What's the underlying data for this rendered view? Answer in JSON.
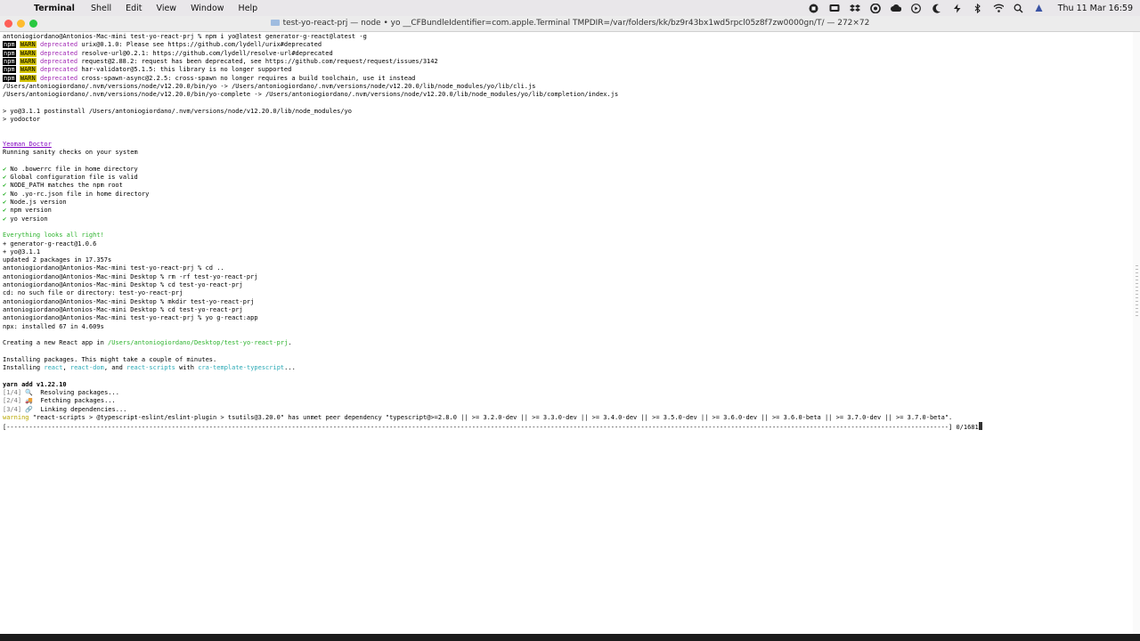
{
  "menubar": {
    "apple_glyph": "",
    "items": [
      "Terminal",
      "Shell",
      "Edit",
      "View",
      "Window",
      "Help"
    ],
    "clock": "Thu 11 Mar  16:59"
  },
  "window": {
    "title": "test-yo-react-prj — node • yo __CFBundleIdentifier=com.apple.Terminal TMPDIR=/var/folders/kk/bz9r43bx1wd5rpcl05z8f7zw0000gn/T/ — 272×72"
  },
  "terminal": {
    "lines": [
      {
        "segs": [
          [
            "",
            "antoniogiordano@Antonios-Mac-mini test-yo-react-prj % npm i yo@latest generator-g-react@latest -g"
          ]
        ]
      },
      {
        "segs": [
          [
            "npm",
            "npm"
          ],
          [
            "",
            " "
          ],
          [
            "warn",
            "WARN"
          ],
          [
            "",
            " "
          ],
          [
            "mag",
            "deprecated"
          ],
          [
            "",
            " urix@0.1.0: Please see https://github.com/lydell/urix#deprecated"
          ]
        ]
      },
      {
        "segs": [
          [
            "npm",
            "npm"
          ],
          [
            "",
            " "
          ],
          [
            "warn",
            "WARN"
          ],
          [
            "",
            " "
          ],
          [
            "mag",
            "deprecated"
          ],
          [
            "",
            " resolve-url@0.2.1: https://github.com/lydell/resolve-url#deprecated"
          ]
        ]
      },
      {
        "segs": [
          [
            "npm",
            "npm"
          ],
          [
            "",
            " "
          ],
          [
            "warn",
            "WARN"
          ],
          [
            "",
            " "
          ],
          [
            "mag",
            "deprecated"
          ],
          [
            "",
            " request@2.88.2: request has been deprecated, see https://github.com/request/request/issues/3142"
          ]
        ]
      },
      {
        "segs": [
          [
            "npm",
            "npm"
          ],
          [
            "",
            " "
          ],
          [
            "warn",
            "WARN"
          ],
          [
            "",
            " "
          ],
          [
            "mag",
            "deprecated"
          ],
          [
            "",
            " har-validator@5.1.5: this library is no longer supported"
          ]
        ]
      },
      {
        "segs": [
          [
            "npm",
            "npm"
          ],
          [
            "",
            " "
          ],
          [
            "warn",
            "WARN"
          ],
          [
            "",
            " "
          ],
          [
            "mag",
            "deprecated"
          ],
          [
            "",
            " cross-spawn-async@2.2.5: cross-spawn no longer requires a build toolchain, use it instead"
          ]
        ]
      },
      {
        "segs": [
          [
            "",
            "/Users/antoniogiordano/.nvm/versions/node/v12.20.0/bin/yo -> /Users/antoniogiordano/.nvm/versions/node/v12.20.0/lib/node_modules/yo/lib/cli.js"
          ]
        ]
      },
      {
        "segs": [
          [
            "",
            "/Users/antoniogiordano/.nvm/versions/node/v12.20.0/bin/yo-complete -> /Users/antoniogiordano/.nvm/versions/node/v12.20.0/lib/node_modules/yo/lib/completion/index.js"
          ]
        ]
      },
      {
        "segs": [
          [
            "",
            ""
          ]
        ]
      },
      {
        "segs": [
          [
            "",
            "> yo@3.1.1 postinstall /Users/antoniogiordano/.nvm/versions/node/v12.20.0/lib/node_modules/yo"
          ]
        ]
      },
      {
        "segs": [
          [
            "",
            "> yodoctor"
          ]
        ]
      },
      {
        "segs": [
          [
            "",
            ""
          ]
        ]
      },
      {
        "segs": [
          [
            "",
            ""
          ]
        ]
      },
      {
        "segs": [
          [
            "link",
            "Yeoman Doctor"
          ]
        ]
      },
      {
        "segs": [
          [
            "",
            "Running sanity checks on your system"
          ]
        ]
      },
      {
        "segs": [
          [
            "",
            ""
          ]
        ]
      },
      {
        "segs": [
          [
            "green",
            "✔"
          ],
          [
            "",
            " No .bowerrc file in home directory"
          ]
        ]
      },
      {
        "segs": [
          [
            "green",
            "✔"
          ],
          [
            "",
            " Global configuration file is valid"
          ]
        ]
      },
      {
        "segs": [
          [
            "green",
            "✔"
          ],
          [
            "",
            " NODE_PATH matches the npm root"
          ]
        ]
      },
      {
        "segs": [
          [
            "green",
            "✔"
          ],
          [
            "",
            " No .yo-rc.json file in home directory"
          ]
        ]
      },
      {
        "segs": [
          [
            "green",
            "✔"
          ],
          [
            "",
            " Node.js version"
          ]
        ]
      },
      {
        "segs": [
          [
            "green",
            "✔"
          ],
          [
            "",
            " npm version"
          ]
        ]
      },
      {
        "segs": [
          [
            "green",
            "✔"
          ],
          [
            "",
            " yo version"
          ]
        ]
      },
      {
        "segs": [
          [
            "",
            ""
          ]
        ]
      },
      {
        "segs": [
          [
            "green",
            "Everything looks all right!"
          ]
        ]
      },
      {
        "segs": [
          [
            "",
            "+ generator-g-react@1.0.6"
          ]
        ]
      },
      {
        "segs": [
          [
            "",
            "+ yo@3.1.1"
          ]
        ]
      },
      {
        "segs": [
          [
            "",
            "updated 2 packages in 17.357s"
          ]
        ]
      },
      {
        "segs": [
          [
            "",
            "antoniogiordano@Antonios-Mac-mini test-yo-react-prj % cd .."
          ]
        ]
      },
      {
        "segs": [
          [
            "",
            "antoniogiordano@Antonios-Mac-mini Desktop % rm -rf test-yo-react-prj"
          ]
        ]
      },
      {
        "segs": [
          [
            "",
            "antoniogiordano@Antonios-Mac-mini Desktop % cd test-yo-react-prj"
          ]
        ]
      },
      {
        "segs": [
          [
            "",
            "cd: no such file or directory: test-yo-react-prj"
          ]
        ]
      },
      {
        "segs": [
          [
            "",
            "antoniogiordano@Antonios-Mac-mini Desktop % mkdir test-yo-react-prj"
          ]
        ]
      },
      {
        "segs": [
          [
            "",
            "antoniogiordano@Antonios-Mac-mini Desktop % cd test-yo-react-prj"
          ]
        ]
      },
      {
        "segs": [
          [
            "",
            "antoniogiordano@Antonios-Mac-mini test-yo-react-prj % yo g-react:app"
          ]
        ]
      },
      {
        "segs": [
          [
            "",
            "npx: installed 67 in 4.609s"
          ]
        ]
      },
      {
        "segs": [
          [
            "",
            ""
          ]
        ]
      },
      {
        "segs": [
          [
            "",
            "Creating a new React app in "
          ],
          [
            "green",
            "/Users/antoniogiordano/Desktop/test-yo-react-prj"
          ],
          [
            "",
            "."
          ]
        ]
      },
      {
        "segs": [
          [
            "",
            ""
          ]
        ]
      },
      {
        "segs": [
          [
            "",
            "Installing packages. This might take a couple of minutes."
          ]
        ]
      },
      {
        "segs": [
          [
            "",
            "Installing "
          ],
          [
            "cyan",
            "react"
          ],
          [
            "",
            ", "
          ],
          [
            "cyan",
            "react-dom"
          ],
          [
            "",
            ", and "
          ],
          [
            "cyan",
            "react-scripts"
          ],
          [
            "",
            " with "
          ],
          [
            "cyan",
            "cra-template-typescript"
          ],
          [
            "",
            "..."
          ]
        ]
      },
      {
        "segs": [
          [
            "",
            ""
          ]
        ]
      },
      {
        "segs": [
          [
            "bold",
            "yarn add v1.22.10"
          ]
        ]
      },
      {
        "segs": [
          [
            "gray",
            "[1/4]"
          ],
          [
            "",
            " 🔍  Resolving packages..."
          ]
        ]
      },
      {
        "segs": [
          [
            "gray",
            "[2/4]"
          ],
          [
            "",
            " 🚚  Fetching packages..."
          ]
        ]
      },
      {
        "segs": [
          [
            "gray",
            "[3/4]"
          ],
          [
            "",
            " 🔗  Linking dependencies..."
          ]
        ]
      },
      {
        "segs": [
          [
            "yellow",
            "warning"
          ],
          [
            "",
            " \"react-scripts > @typescript-eslint/eslint-plugin > tsutils@3.20.0\" has unmet peer dependency \"typescript@>=2.8.0 || >= 3.2.0-dev || >= 3.3.0-dev || >= 3.4.0-dev || >= 3.5.0-dev || >= 3.6.0-dev || >= 3.6.0-beta || >= 3.7.0-dev || >= 3.7.0-beta\"."
          ]
        ]
      },
      {
        "segs": [
          [
            "",
            "[-----------------------------------------------------------------------------------------------------------------------------------------------------------------------------------------------------------------------------------------------------------] 0/1681"
          ],
          [
            "cursor",
            ""
          ]
        ]
      }
    ]
  },
  "colors": {
    "menubar_bg": "#e9e7ea",
    "close": "#fe5f57",
    "minimize": "#febc2e",
    "zoom": "#28c840",
    "warn_bg": "#d4c400",
    "deprecated": "#a229b5",
    "green": "#2db32d",
    "cyan": "#2aa9b5"
  },
  "status_icons": [
    "record-icon",
    "screen-mirroring-icon",
    "dropbox-icon",
    "creative-cloud-icon",
    "cloud-icon",
    "play-icon",
    "moon-icon",
    "battery-icon",
    "bluetooth-icon",
    "wifi-icon",
    "search-icon",
    "user-icon"
  ]
}
